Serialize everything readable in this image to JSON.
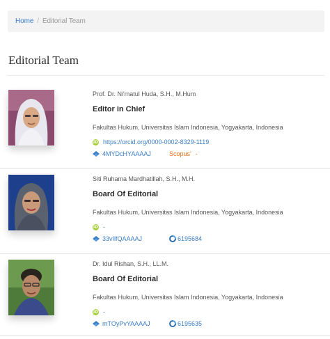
{
  "breadcrumb": {
    "home": "Home",
    "separator": "/",
    "current": "Editorial Team"
  },
  "page": {
    "title": "Editorial Team"
  },
  "members": [
    {
      "name": "Prof. Dr. Ni'matul Huda, S.H., M.Hum",
      "role": "Editor in Chief",
      "affiliation": "Fakultas Hukum, Universitas Islam Indonesia, Yogyakarta, Indonesia",
      "orcid": "https://orcid.org/0000-0002-8329-1119",
      "scholar_id": "4MYDcHYAAAAJ",
      "scopus_label": "Scopus'",
      "scopus_value": "-"
    },
    {
      "name": "Siti Ruhama Mardhatillah, S.H., M.H.",
      "role": "Board Of Editorial",
      "affiliation": "Fakultas Hukum, Universitas Islam Indonesia, Yogyakarta, Indonesia",
      "orcid": "-",
      "scholar_id": "33vIlfQAAAAJ",
      "sinta_id": "6195684"
    },
    {
      "name": "Dr. Idul Rishan, S.H., LL.M.",
      "role": "Board Of Editorial",
      "affiliation": "Fakultas Hukum, Universitas Islam Indonesia, Yogyakarta, Indonesia",
      "orcid": "-",
      "scholar_id": "mTOyPvYAAAAJ",
      "sinta_id": "6195635"
    }
  ],
  "colors": {
    "link": "#3b7dc4",
    "scopus": "#e9711c",
    "orcid": "#a6ce39"
  }
}
